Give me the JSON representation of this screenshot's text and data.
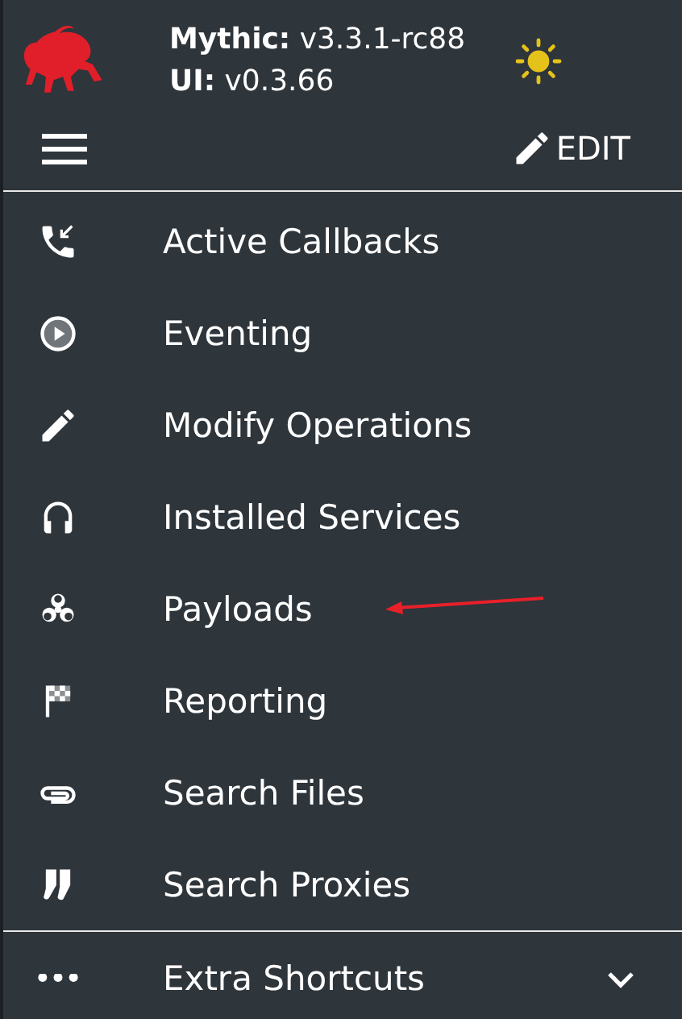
{
  "header": {
    "version_lines": [
      "**Mythic:** v3.3.1-rc88",
      "**UI:** v0.3.66"
    ],
    "edit_label": "EDIT"
  },
  "menu": [
    {
      "label": "Active Callbacks",
      "highlighted": false
    },
    {
      "label": "Eventing",
      "highlighted": false
    },
    {
      "label": "Modify Operations",
      "highlighted": false
    },
    {
      "label": "Installed Services",
      "highlighted": false
    },
    {
      "label": "Payloads",
      "highlighted": true
    },
    {
      "label": "Reporting",
      "highlighted": false
    },
    {
      "label": "Search Files",
      "highlighted": false
    },
    {
      "label": "Search Proxies",
      "highlighted": false
    }
  ],
  "footer": {
    "label": "Extra Shortcuts",
    "expanded": false
  }
}
